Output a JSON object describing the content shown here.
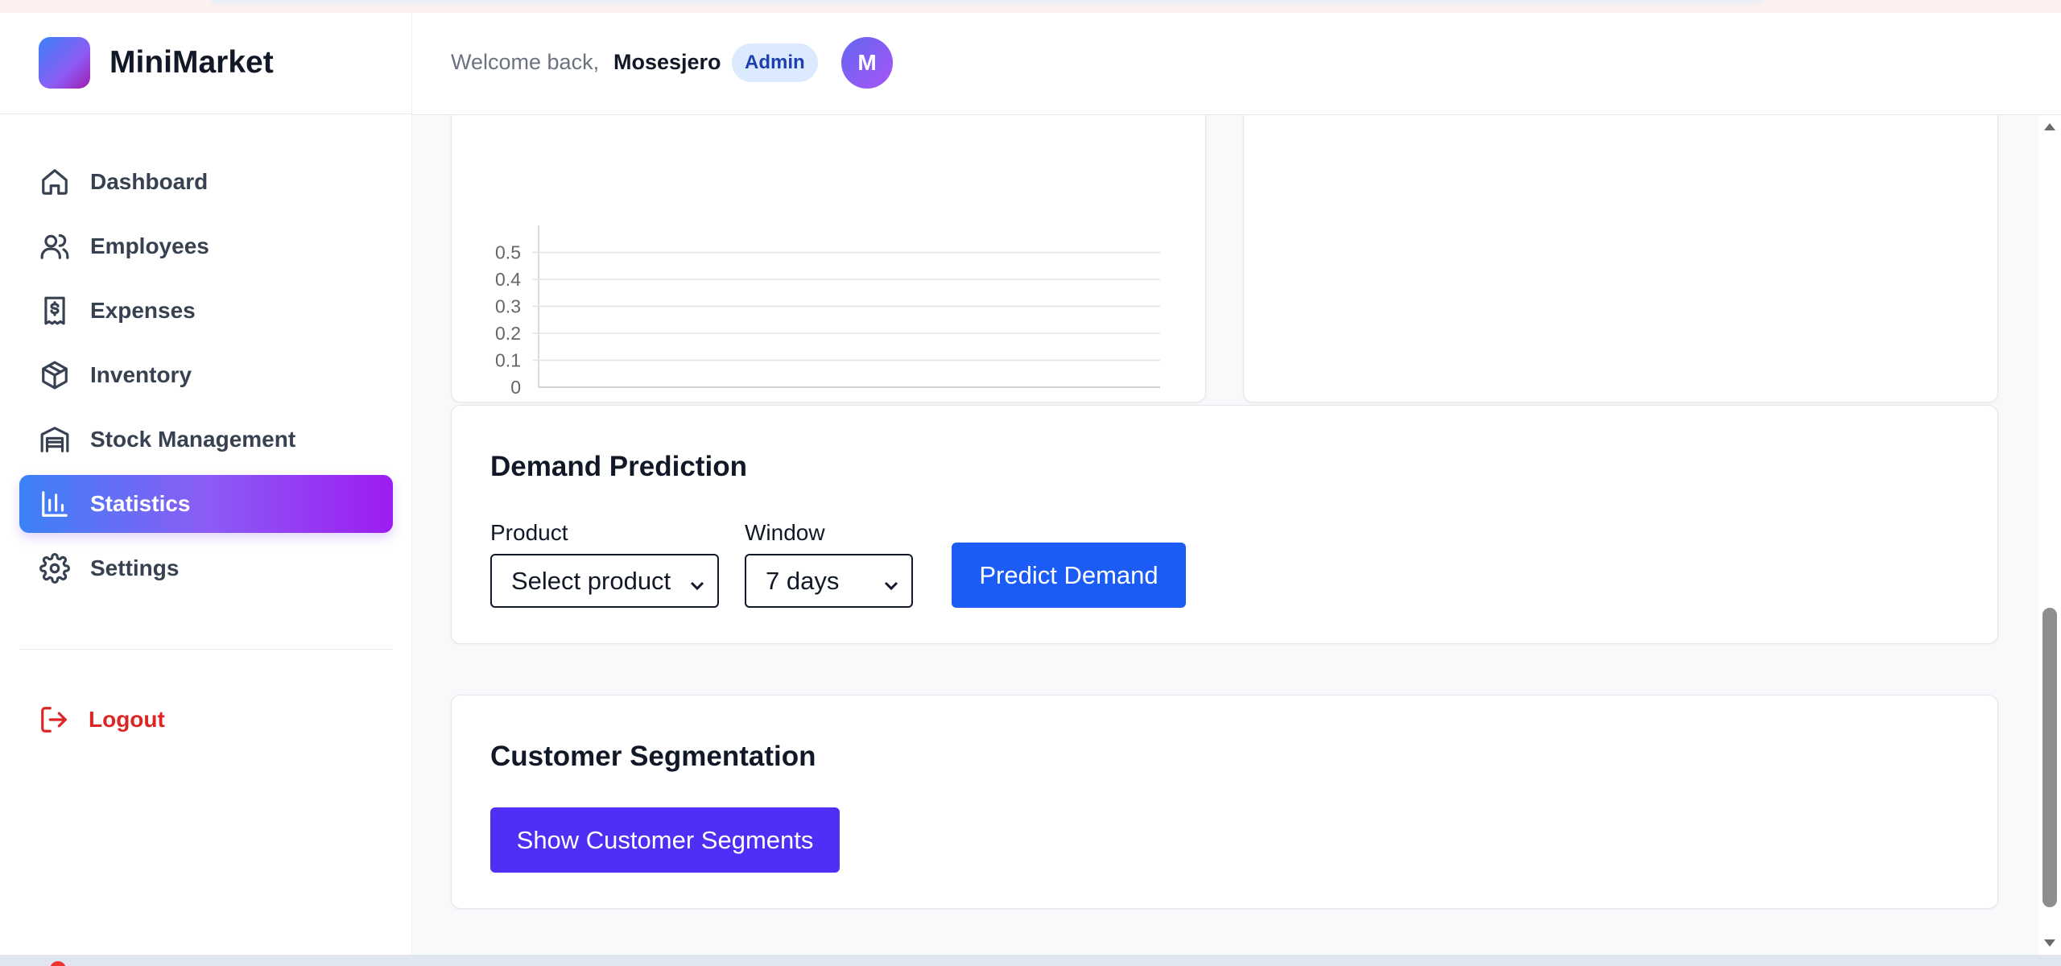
{
  "app": {
    "name": "MiniMarket"
  },
  "sidebar": {
    "items": [
      {
        "label": "Dashboard",
        "icon": "home-icon"
      },
      {
        "label": "Employees",
        "icon": "users-icon"
      },
      {
        "label": "Expenses",
        "icon": "receipt-dollar-icon"
      },
      {
        "label": "Inventory",
        "icon": "package-icon"
      },
      {
        "label": "Stock Management",
        "icon": "warehouse-icon"
      },
      {
        "label": "Statistics",
        "icon": "bar-chart-icon",
        "active": true
      },
      {
        "label": "Settings",
        "icon": "gear-icon"
      }
    ],
    "logout_label": "Logout"
  },
  "header": {
    "welcome": "Welcome back,",
    "username": "Mosesjero",
    "role": "Admin",
    "avatar_initial": "M"
  },
  "chart_data": {
    "type": "line",
    "y_ticks": [
      "0",
      "0.1",
      "0.2",
      "0.3",
      "0.4",
      "0.5"
    ],
    "ylim": [
      0,
      0.6
    ],
    "series": [],
    "grid": true
  },
  "demand": {
    "title": "Demand Prediction",
    "product_label": "Product",
    "product_value": "Select product",
    "window_label": "Window",
    "window_value": "7 days",
    "predict_label": "Predict Demand"
  },
  "segmentation": {
    "title": "Customer Segmentation",
    "button_label": "Show Customer Segments"
  },
  "colors": {
    "primary": "#1a5cf5",
    "indigo": "#4f2ef5",
    "active_gradient_start": "#3b82f6",
    "active_gradient_end": "#9d1cf0",
    "danger": "#dc2626",
    "badge_bg": "#dbeafe"
  }
}
